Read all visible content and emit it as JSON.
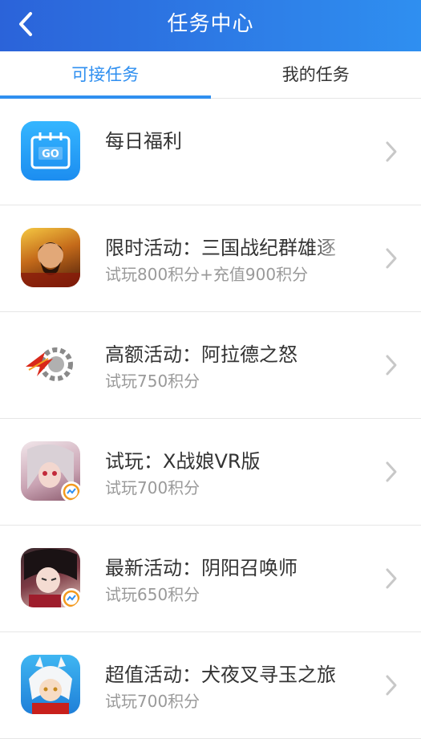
{
  "header": {
    "title": "任务中心",
    "back_icon": "chevron-left-icon"
  },
  "tabs": [
    {
      "label": "可接任务",
      "active": true
    },
    {
      "label": "我的任务",
      "active": false
    }
  ],
  "tasks": [
    {
      "title": "每日福利",
      "subtitle": "",
      "icon": "daily-go-icon"
    },
    {
      "title": "限时活动：三国战纪群雄逐",
      "subtitle": "试玩800积分+充值900积分",
      "icon": "game-icon-sanguo"
    },
    {
      "title": "高额活动：阿拉德之怒",
      "subtitle": "试玩750积分",
      "icon": "game-icon-alade"
    },
    {
      "title": "试玩：X战娘VR版",
      "subtitle": "试玩700积分",
      "icon": "game-icon-xzhanniang"
    },
    {
      "title": "最新活动：阴阳召唤师",
      "subtitle": "试玩650积分",
      "icon": "game-icon-yinyang"
    },
    {
      "title": "超值活动：犬夜叉寻玉之旅",
      "subtitle": "试玩700积分",
      "icon": "game-icon-inuyasha"
    }
  ],
  "colors": {
    "accent": "#2f8ff0",
    "header_start": "#2b63d9",
    "header_end": "#2f8ff0",
    "subtitle": "#9a9a9a"
  }
}
